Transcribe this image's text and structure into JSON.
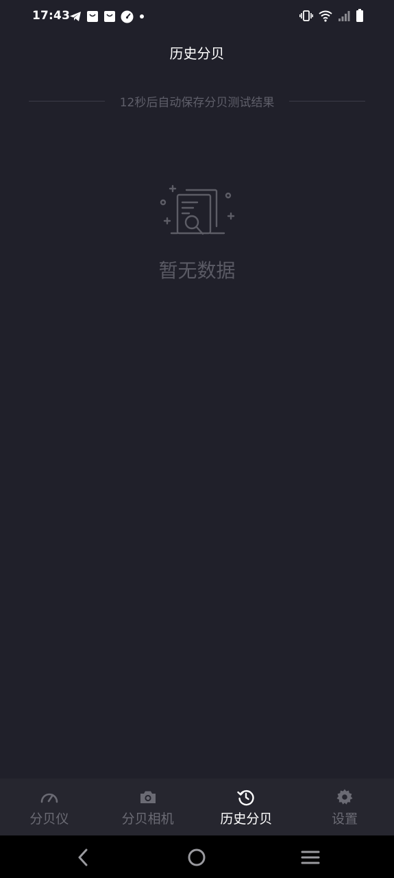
{
  "status_bar": {
    "time": "17:43",
    "left_icons": [
      "telegram-icon",
      "shopping-bag-icon",
      "shopping-bag-icon",
      "speedometer-app-icon",
      "notification-dot-icon"
    ],
    "right_icons": [
      "vibrate-icon",
      "wifi-icon",
      "signal-icon",
      "battery-icon"
    ]
  },
  "header": {
    "title": "历史分贝"
  },
  "notice": {
    "text": "12秒后自动保存分贝测试结果"
  },
  "empty_state": {
    "icon": "document-search-icon",
    "message": "暂无数据"
  },
  "bottom_nav": {
    "items": [
      {
        "label": "分贝仪",
        "icon": "speedometer-icon",
        "active": false
      },
      {
        "label": "分贝相机",
        "icon": "camera-icon",
        "active": false
      },
      {
        "label": "历史分贝",
        "icon": "history-icon",
        "active": true
      },
      {
        "label": "设置",
        "icon": "gear-icon",
        "active": false
      }
    ]
  },
  "system_nav": {
    "buttons": [
      "back-icon",
      "home-icon",
      "menu-icon"
    ]
  },
  "colors": {
    "background": "#20202a",
    "nav_background": "#26262f",
    "active": "#ffffff",
    "inactive": "#6b6b74"
  }
}
